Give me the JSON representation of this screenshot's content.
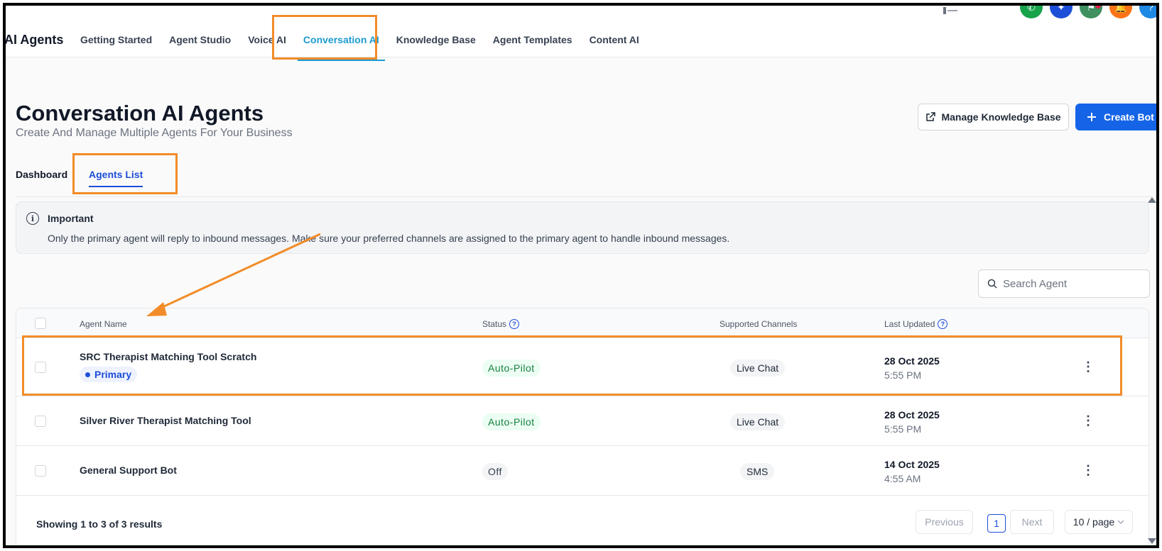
{
  "brand": "AI Agents",
  "nav": {
    "tabs": [
      {
        "label": "Getting Started"
      },
      {
        "label": "Agent Studio"
      },
      {
        "label": "Voice AI"
      },
      {
        "label": "Conversation AI"
      },
      {
        "label": "Knowledge Base"
      },
      {
        "label": "Agent Templates"
      },
      {
        "label": "Content AI"
      }
    ],
    "active": "Conversation AI"
  },
  "top_icons": [
    {
      "name": "phone-icon",
      "color": "#16a34a"
    },
    {
      "name": "sparkle-icon",
      "color": "#1d4ed8"
    },
    {
      "name": "megaphone-icon",
      "color": "#3f8f5f"
    },
    {
      "name": "bell-icon",
      "color": "#f97316"
    },
    {
      "name": "help-icon",
      "color": "#1e88e5"
    }
  ],
  "page": {
    "title": "Conversation AI Agents",
    "subtitle": "Create And Manage Multiple Agents For Your Business",
    "manage_kb_label": "Manage Knowledge Base",
    "create_bot_label": "Create Bot"
  },
  "subtabs": [
    {
      "label": "Dashboard"
    },
    {
      "label": "Agents List"
    }
  ],
  "alert": {
    "title": "Important",
    "body": "Only the primary agent will reply to inbound messages. Make sure your preferred channels are assigned to the primary agent to handle inbound messages."
  },
  "search": {
    "placeholder": "Search Agent"
  },
  "table": {
    "columns": [
      "Agent Name",
      "Status",
      "Supported Channels",
      "Last Updated"
    ],
    "rows": [
      {
        "name": "SRC Therapist Matching Tool Scratch",
        "badge": "Primary",
        "status": "Auto-Pilot",
        "channel": "Live Chat",
        "date": "28 Oct 2025",
        "time": "5:55 PM"
      },
      {
        "name": "Silver River Therapist Matching Tool",
        "badge": "",
        "status": "Auto-Pilot",
        "channel": "Live Chat",
        "date": "28 Oct 2025",
        "time": "5:55 PM"
      },
      {
        "name": "General Support Bot",
        "badge": "",
        "status": "Off",
        "channel": "SMS",
        "date": "14 Oct 2025",
        "time": "4:55 AM"
      }
    ]
  },
  "pagination": {
    "summary": "Showing 1 to 3 of 3 results",
    "previous": "Previous",
    "page": "1",
    "next": "Next",
    "per_page": "10 / page"
  },
  "annotation_color": "#f28c28"
}
